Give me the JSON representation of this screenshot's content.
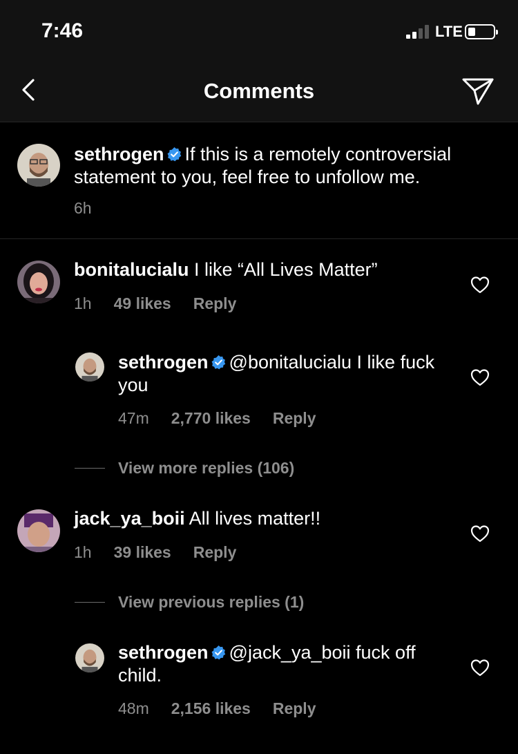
{
  "status_bar": {
    "time": "7:46",
    "network": "LTE"
  },
  "nav": {
    "title": "Comments"
  },
  "caption": {
    "username": "sethrogen",
    "text": "If this is a remotely controversial statement to you, feel free to unfollow me.",
    "time": "6h"
  },
  "comments": [
    {
      "username": "bonitalucialu",
      "text": "I like “All Lives Matter”",
      "time": "1h",
      "likes": "49 likes",
      "reply_label": "Reply",
      "replies": [
        {
          "username": "sethrogen",
          "text": "@bonitalucialu I like fuck you",
          "time": "47m",
          "likes": "2,770 likes",
          "reply_label": "Reply"
        }
      ],
      "view_more": "View more replies (106)"
    },
    {
      "username": "jack_ya_boii",
      "text": "All lives matter!!",
      "time": "1h",
      "likes": "39 likes",
      "reply_label": "Reply",
      "view_previous": "View previous replies (1)",
      "replies": [
        {
          "username": "sethrogen",
          "text": "@jack_ya_boii fuck off child.",
          "time": "48m",
          "likes": "2,156 likes",
          "reply_label": "Reply"
        }
      ]
    }
  ],
  "colors": {
    "background": "#000000",
    "bar_background": "#121212",
    "secondary_text": "#8e8e8e",
    "verified_blue": "#3897f0"
  },
  "icons": [
    "back-chevron-icon",
    "send-icon",
    "verified-icon",
    "heart-icon",
    "signal-icon",
    "battery-icon"
  ]
}
